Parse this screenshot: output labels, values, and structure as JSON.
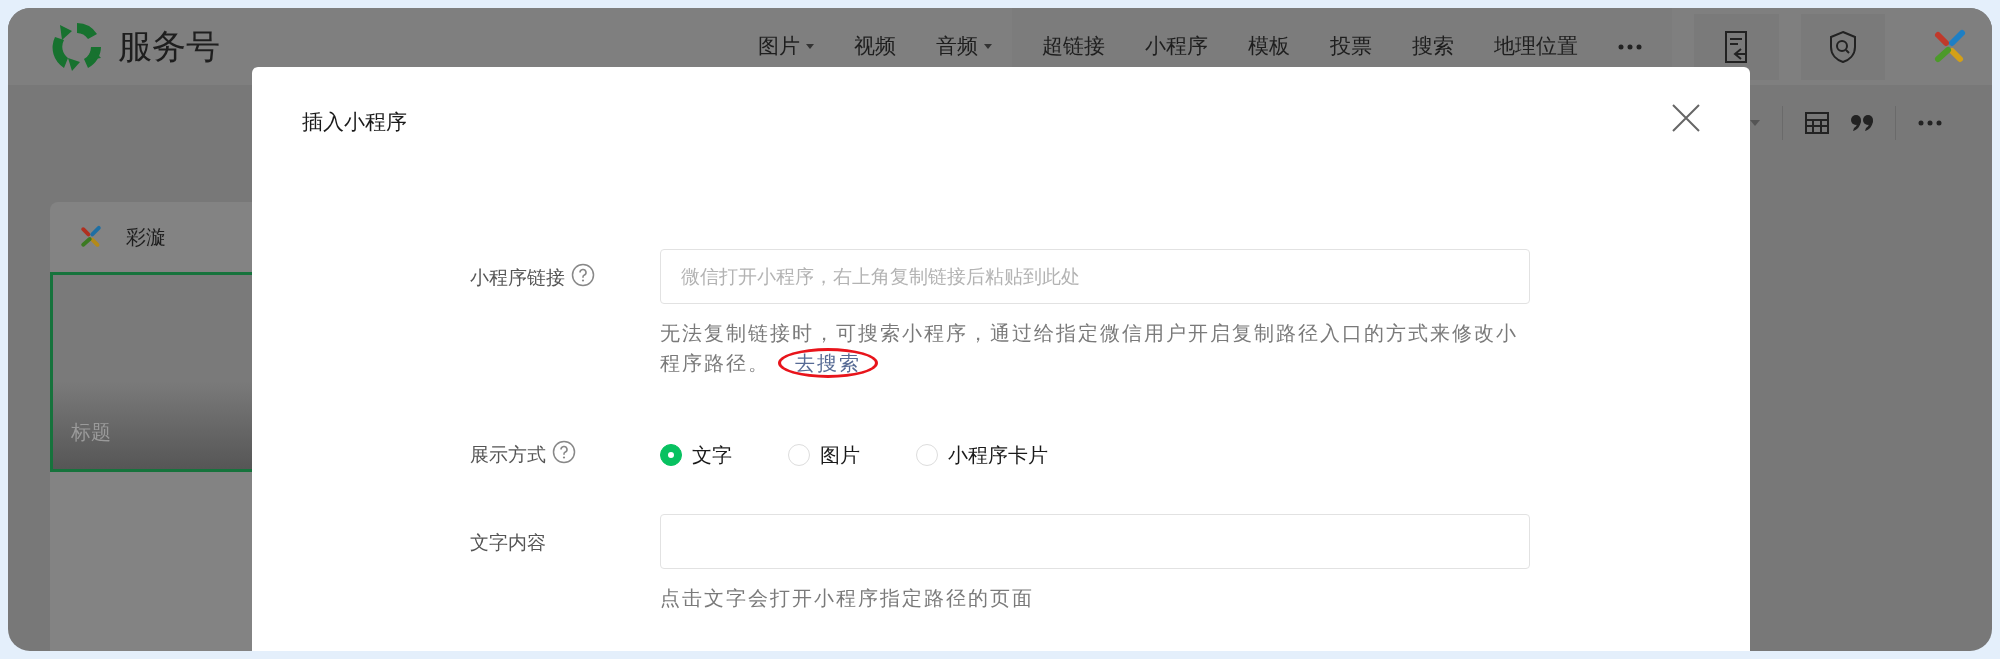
{
  "app": {
    "name": "服务号"
  },
  "media_nav": [
    {
      "label": "图片",
      "dropdown": true
    },
    {
      "label": "视频",
      "dropdown": false
    },
    {
      "label": "音频",
      "dropdown": true
    }
  ],
  "insert_nav": [
    {
      "label": "超链接"
    },
    {
      "label": "小程序"
    },
    {
      "label": "模板"
    },
    {
      "label": "投票"
    },
    {
      "label": "搜索"
    },
    {
      "label": "地理位置"
    }
  ],
  "account": {
    "name": "彩漩"
  },
  "cover": {
    "title": "标题",
    "selected": true
  },
  "dialog": {
    "title": "插入小程序",
    "fields": [
      {
        "kind": "text",
        "label": "小程序链接",
        "help_icon": true,
        "placeholder": "微信打开小程序，右上角复制链接后粘贴到此处",
        "hint": "无法复制链接时，可搜索小程序，通过给指定微信用户开启复制路径入口的方式来修改小程序路径。",
        "hint_link": "去搜索"
      },
      {
        "kind": "radio",
        "label": "展示方式",
        "help_icon": true,
        "options": [
          {
            "label": "文字",
            "selected": true
          },
          {
            "label": "图片",
            "selected": false
          },
          {
            "label": "小程序卡片",
            "selected": false
          }
        ]
      },
      {
        "kind": "text",
        "label": "文字内容",
        "hint": "点击文字会打开小程序指定路径的页面"
      }
    ]
  }
}
